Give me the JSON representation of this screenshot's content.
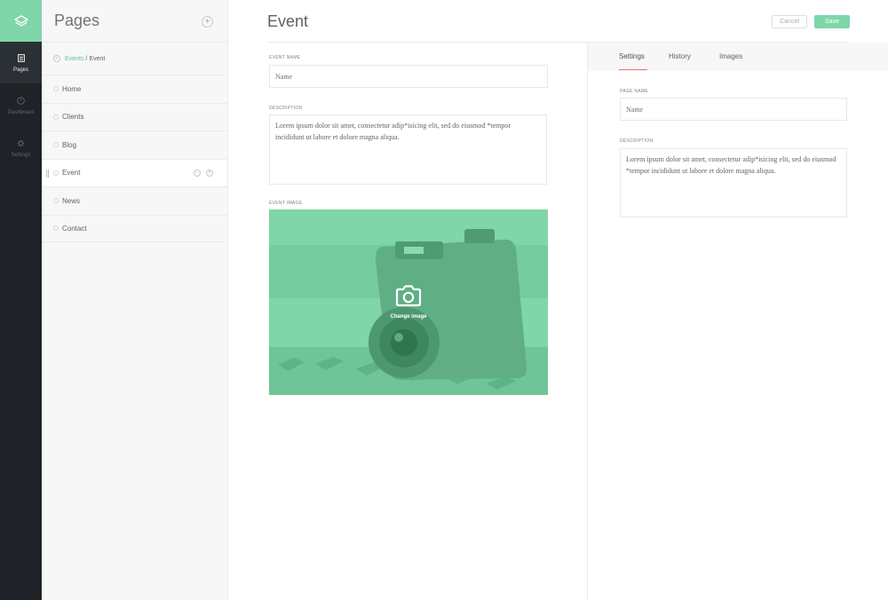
{
  "rail": {
    "items": [
      {
        "label": "Pages",
        "icon": "pages-icon",
        "active": true
      },
      {
        "label": "Dashboard",
        "icon": "dashboard-icon",
        "active": false
      },
      {
        "label": "Settings",
        "icon": "gear-icon",
        "active": false
      }
    ],
    "accent": "#7fd6a8"
  },
  "sidebar": {
    "title": "Pages",
    "add_icon": "plus-icon",
    "breadcrumb": {
      "parent": "Events",
      "separator": "/",
      "current": "Event"
    },
    "pages": [
      "Home",
      "Clients",
      "Blog",
      "Event",
      "News",
      "Contact"
    ],
    "active_page": "Event"
  },
  "main": {
    "title": "Event",
    "cancel_label": "Cancel",
    "save_label": "Save",
    "event_name_label": "Event Name",
    "event_name_placeholder": "Name",
    "description_label": "Description",
    "description_value": "Lorem ipsum dolor sit amet, consectetur adip*isicing elit, sed do eiusmod *tempor incididunt ut labore et dolore magna aliqua.",
    "event_image_label": "Event Image",
    "change_image_label": "Change image"
  },
  "panel": {
    "tabs": [
      "Settings",
      "History",
      "Images"
    ],
    "active_tab": "Settings",
    "page_name_label": "Page Name",
    "page_name_placeholder": "Name",
    "description_label": "Description",
    "description_value": "Lorem ipsum dolor sit amet, consectetur adip*isicing elit, sed do eiusmod *tempor incididunt ut labore et dolore magna aliqua."
  },
  "colors": {
    "brand_green": "#7fd6a8",
    "active_tab_underline": "#e8756f",
    "rail_background": "#1f2327"
  }
}
